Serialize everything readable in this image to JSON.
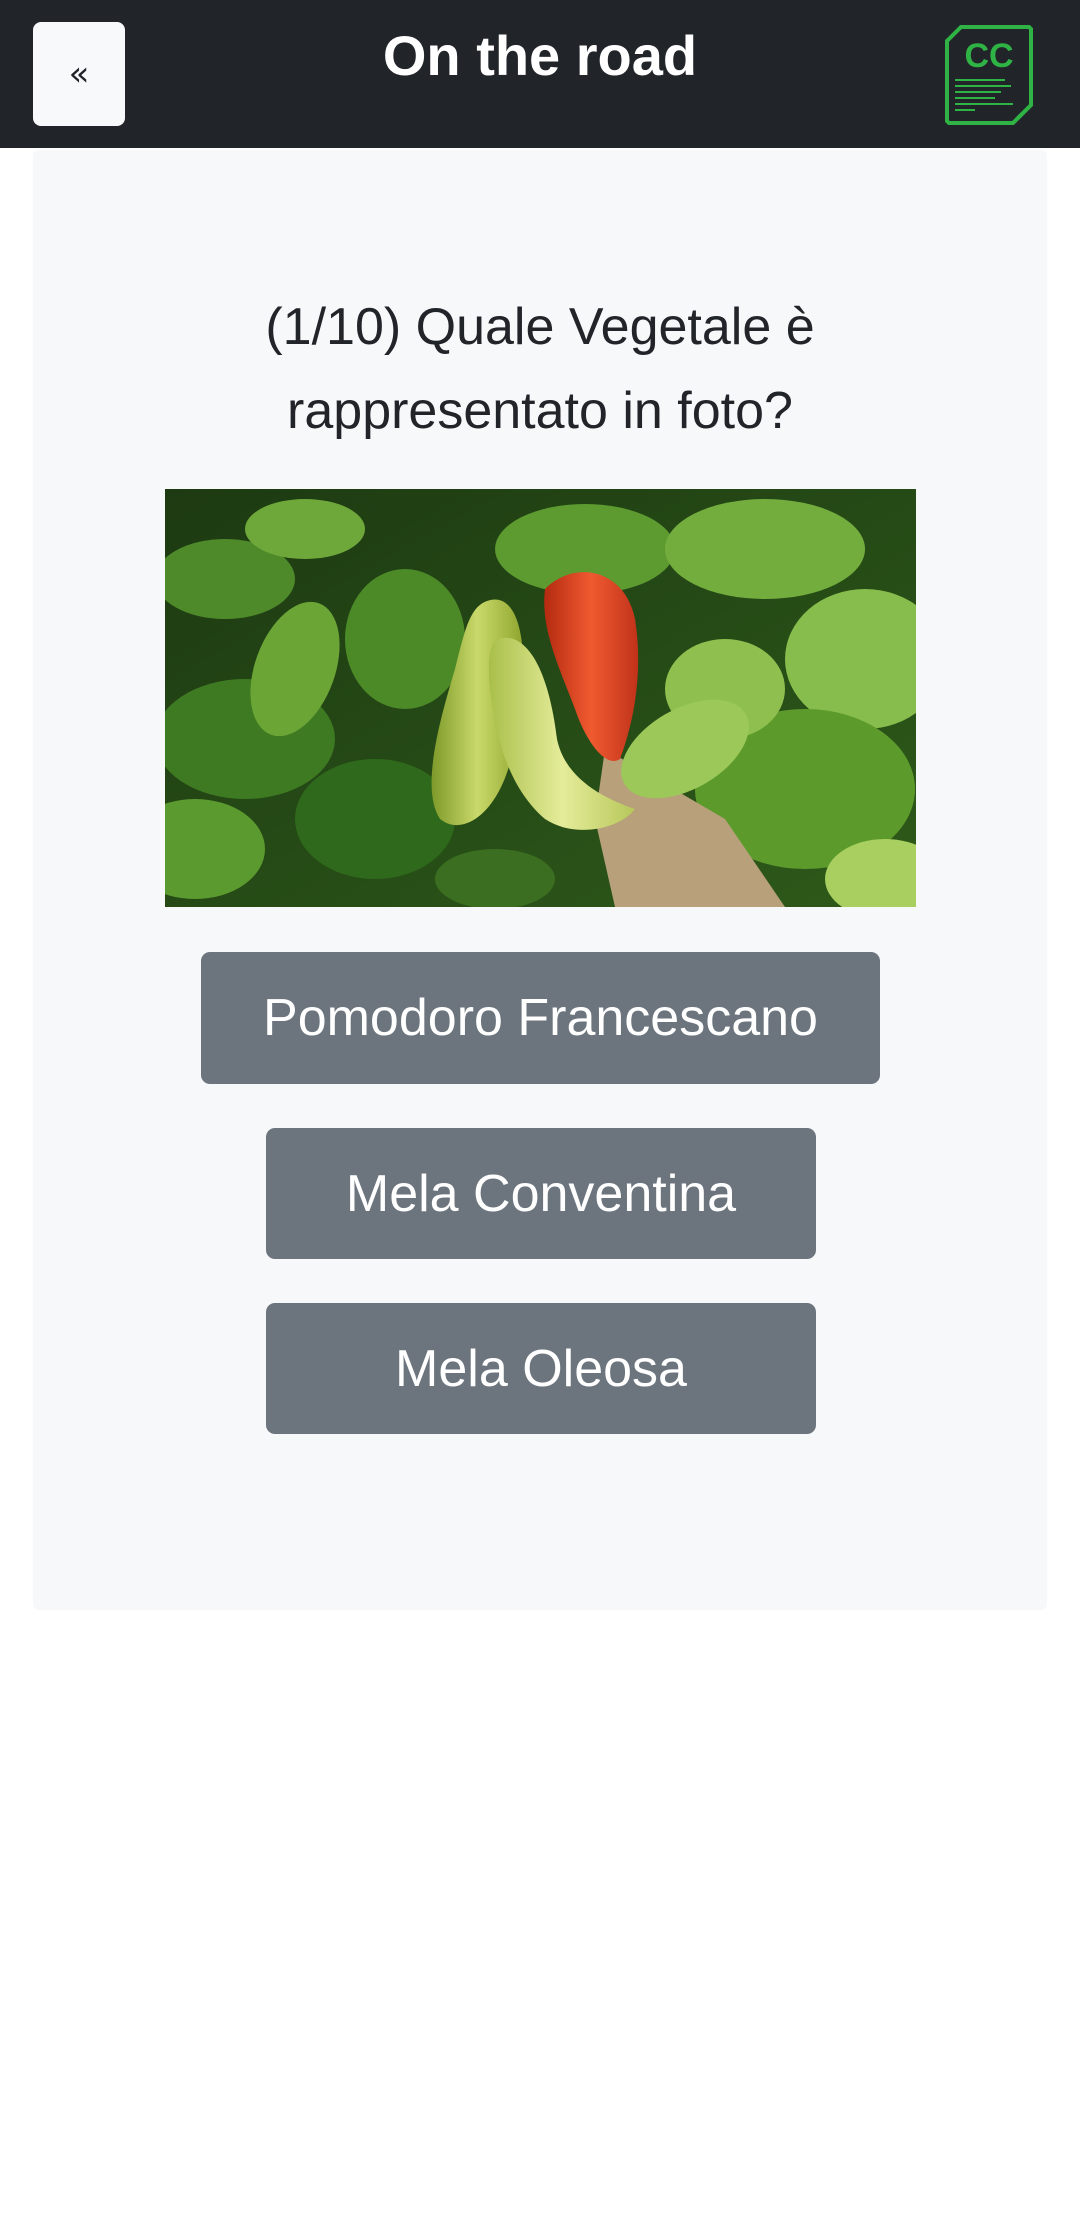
{
  "header": {
    "back_label": "«",
    "title": "On the road",
    "logo_text": "CC"
  },
  "quiz": {
    "question_line1": "(1/10) Quale Vegetale è",
    "question_line2": "rappresentato in foto?",
    "answers": [
      "Pomodoro Francescano",
      "Mela Conventina",
      "Mela Oleosa"
    ]
  },
  "colors": {
    "topbar": "#212529",
    "card": "#f7f8f9",
    "button": "#6c757d",
    "logo_green": "#2fb344"
  }
}
